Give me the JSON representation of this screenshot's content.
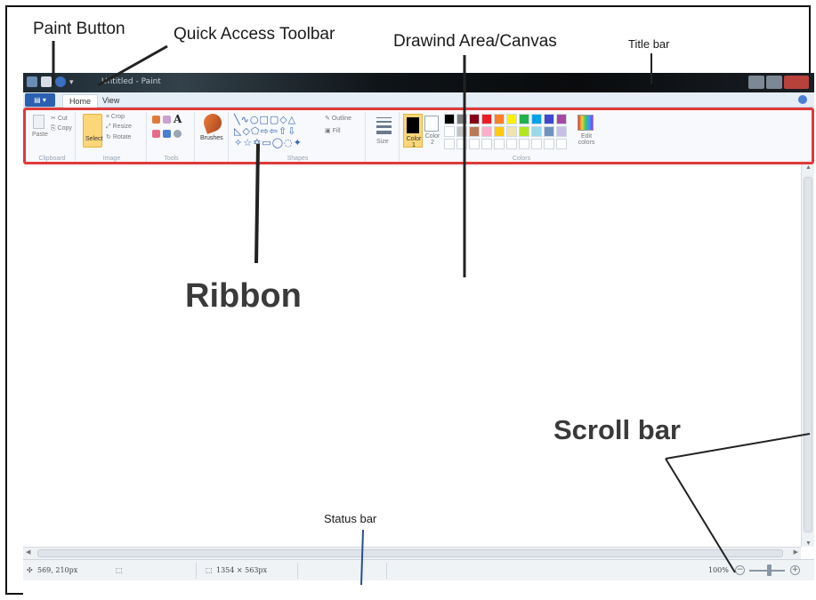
{
  "annotations": {
    "paint_button": "Paint Button",
    "quick_access_toolbar": "Quick Access Toolbar",
    "drawing_area": "Drawind Area/Canvas",
    "title_bar": "Title bar",
    "ribbon": "Ribbon",
    "scroll_bar": "Scroll bar",
    "status_bar": "Status bar"
  },
  "window": {
    "title": "Untitled - Paint"
  },
  "tabs": [
    "Home",
    "View"
  ],
  "ribbon": {
    "clipboard": {
      "label": "Clipboard",
      "paste": "Paste",
      "cut": "Cut",
      "copy": "Copy"
    },
    "image": {
      "label": "Image",
      "select": "Select",
      "crop": "Crop",
      "resize": "Resize",
      "rotate": "Rotate"
    },
    "tools": {
      "label": "Tools",
      "text_tool": "A"
    },
    "brushes": {
      "label": "Brushes"
    },
    "shapes": {
      "label": "Shapes",
      "outline": "Outline",
      "fill": "Fill"
    },
    "size": {
      "label": "Size"
    },
    "colors": {
      "label": "Colors",
      "color1": "Color 1",
      "color2": "Color 2",
      "edit_colors": "Edit colors",
      "palette_row1": [
        "#000000",
        "#7f7f7f",
        "#880015",
        "#ed1c24",
        "#ff7f27",
        "#fff200",
        "#22b14c",
        "#00a2e8",
        "#3f48cc",
        "#a349a4"
      ],
      "palette_row2": [
        "#ffffff",
        "#c3c3c3",
        "#b97a57",
        "#ffaec9",
        "#ffc90e",
        "#efe4b0",
        "#b5e61d",
        "#99d9ea",
        "#7092be",
        "#c8bfe7"
      ]
    }
  },
  "statusbar": {
    "cursor_position": "569, 210px",
    "image_size": "1354 × 563px",
    "zoom": "100%"
  }
}
